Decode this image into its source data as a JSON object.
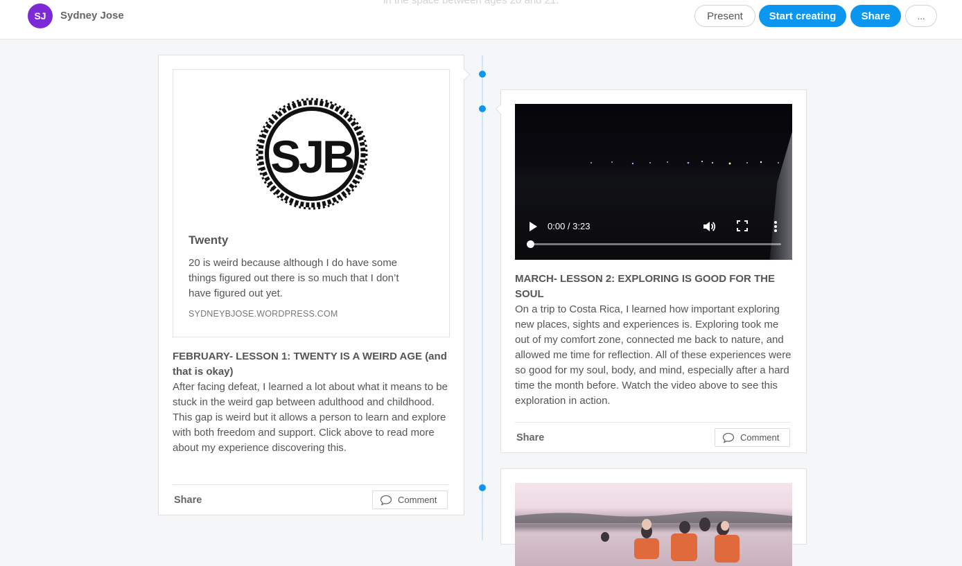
{
  "header": {
    "avatar_initials": "SJ",
    "user_name": "Sydney Jose",
    "subtitle_fragment": "in the space between ages 20 and 21.",
    "buttons": {
      "present": "Present",
      "start_creating": "Start creating",
      "share": "Share",
      "more": "..."
    }
  },
  "posts": [
    {
      "link_preview": {
        "logo_text": "SJB",
        "title": "Twenty",
        "description": "20 is weird because although I do have some things figured out there is so much that I don’t have figured out yet.",
        "domain": "SYDNEYBJOSE.WORDPRESS.COM"
      },
      "title": "FEBRUARY- LESSON 1: TWENTY IS A WEIRD AGE (and that is okay)",
      "body": "After facing defeat, I learned a lot about what it means to be stuck in the weird gap between adulthood and childhood. This gap is weird but it allows a person to learn and explore with both freedom and support. Click above to read more about my experience discovering this.",
      "share_label": "Share",
      "comment_label": "Comment"
    },
    {
      "video": {
        "time": "0:00 / 3:23",
        "progress": 0
      },
      "title": "MARCH- LESSON 2: EXPLORING IS GOOD FOR THE SOUL",
      "body": "On a trip to Costa Rica, I learned how important exploring new places, sights and experiences is. Exploring took me out of my comfort zone, connected me back to nature, and allowed me time for reflection. All of these experiences were so good for my soul, body, and mind, especially after a hard time the month before. Watch the video above to see this exploration in action.",
      "share_label": "Share",
      "comment_label": "Comment"
    },
    {
      "photo_icon": "group-photo-on-lake"
    }
  ],
  "colors": {
    "accent": "#0b96f0",
    "avatar": "#7b2ad6",
    "background": "#f5f6f8"
  },
  "icons": [
    "play-icon",
    "volume-icon",
    "fullscreen-icon",
    "more-vert-icon",
    "comment-icon"
  ]
}
